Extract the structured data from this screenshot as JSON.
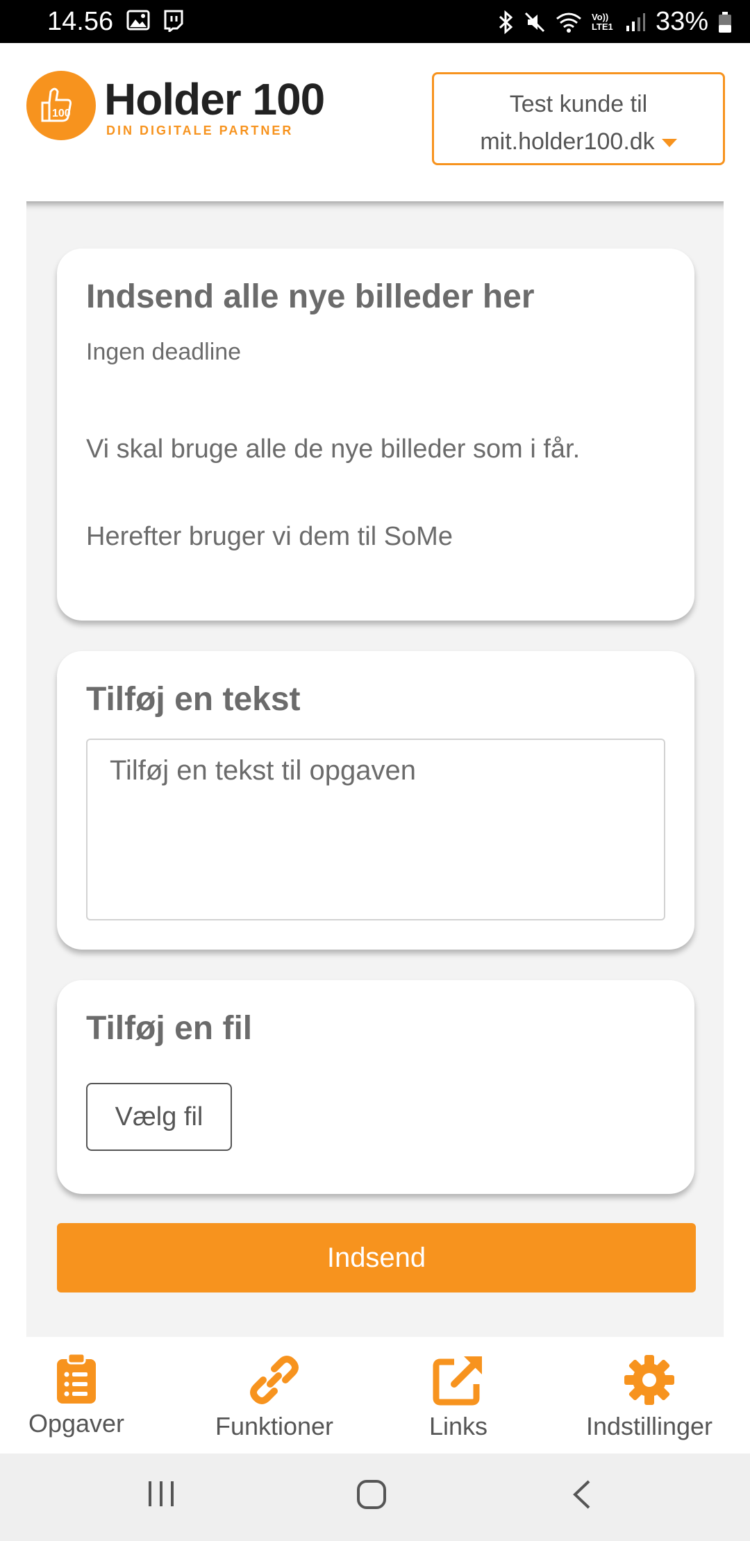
{
  "status_bar": {
    "time": "14.56",
    "battery": "33%",
    "left_icons": [
      "image-icon",
      "twitch-icon"
    ],
    "right_icons": [
      "bluetooth-icon",
      "mute-icon",
      "wifi-icon",
      "volte-icon",
      "signal-icon",
      "battery-icon"
    ],
    "volte_text": "Vo)) LTE1"
  },
  "header": {
    "brand_title": "Holder 100",
    "brand_subtitle": "DIN DIGITALE PARTNER",
    "account_line1": "Test kunde til",
    "account_line2": "mit.holder100.dk"
  },
  "task_card": {
    "title": "Indsend alle nye billeder her",
    "deadline": "Ingen deadline",
    "description_line1": "Vi skal bruge alle de nye billeder som i får.",
    "description_line2": "Herefter bruger vi dem til SoMe"
  },
  "text_card": {
    "title": "Tilføj en tekst",
    "placeholder": "Tilføj en tekst til opgaven",
    "value": ""
  },
  "file_card": {
    "title": "Tilføj en fil",
    "choose_file_label": "Vælg fil"
  },
  "submit_label": "Indsend",
  "accent_color": "#f7931e",
  "bottom_nav": {
    "items": [
      {
        "label": "Opgaver",
        "icon": "clipboard-list-icon"
      },
      {
        "label": "Funktioner",
        "icon": "link-icon"
      },
      {
        "label": "Links",
        "icon": "external-link-icon"
      },
      {
        "label": "Indstillinger",
        "icon": "gear-icon"
      }
    ]
  },
  "system_nav": [
    "recent-apps-icon",
    "home-icon",
    "back-icon"
  ]
}
